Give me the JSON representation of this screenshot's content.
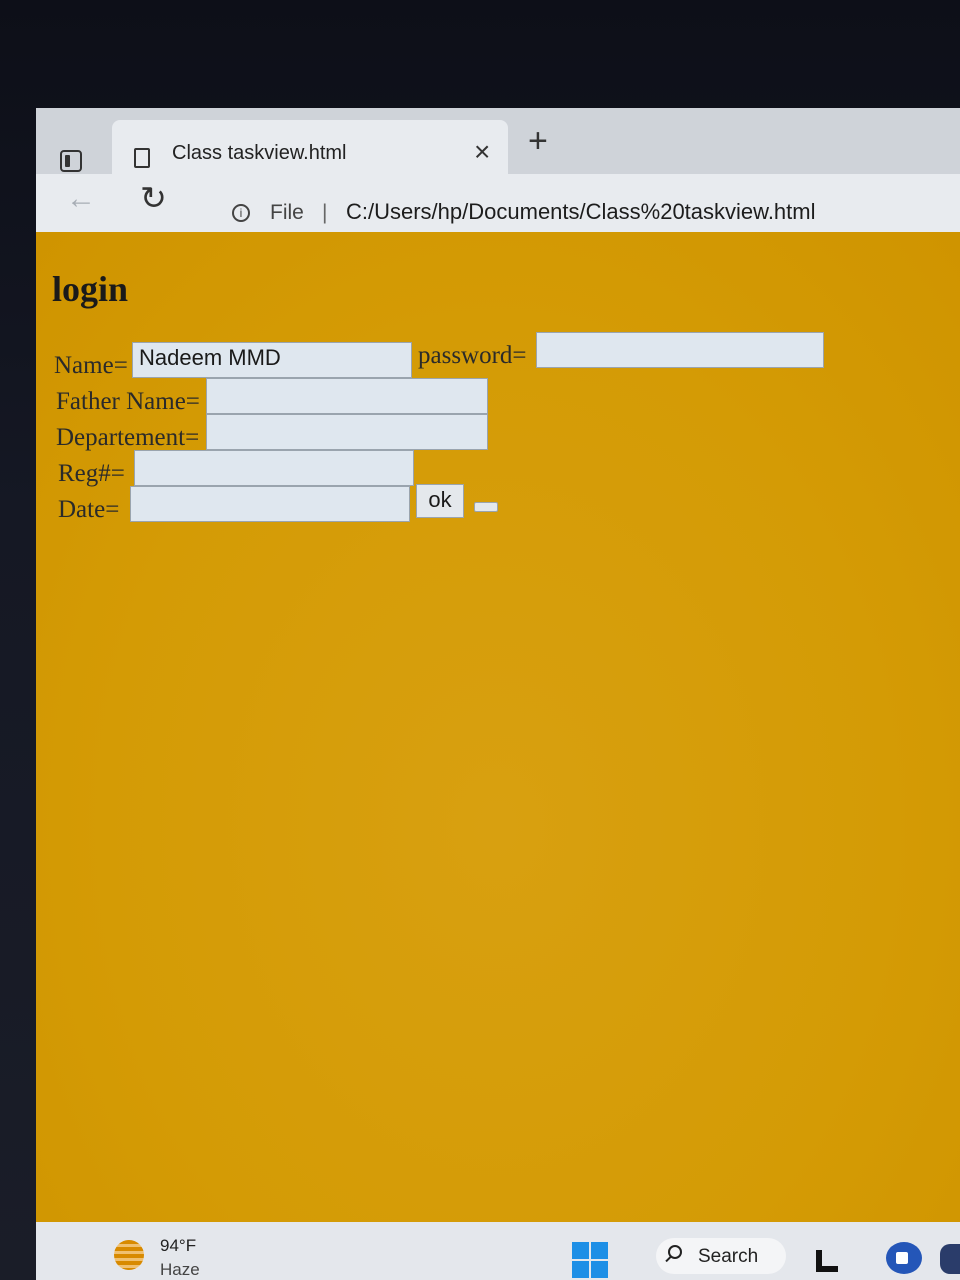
{
  "browser": {
    "tab": {
      "title": "Class taskview.html",
      "close_glyph": "×",
      "page_icon": "document-icon"
    },
    "new_tab_glyph": "+",
    "toolbar": {
      "back_glyph": "←",
      "refresh_glyph": "↻",
      "info_glyph": "i",
      "scheme_label": "File",
      "separator": "|",
      "url": "C:/Users/hp/Documents/Class%20taskview.html"
    }
  },
  "page": {
    "heading": "login",
    "fields": {
      "name_label": "Name=",
      "name_value": "Nadeem MMD",
      "password_label": "password=",
      "password_value": "",
      "father_name_label": "Father Name=",
      "father_name_value": "",
      "department_label": "Departement=",
      "department_value": "",
      "reg_label": "Reg#=",
      "reg_value": "",
      "date_label": "Date=",
      "date_value": ""
    },
    "ok_label": "ok",
    "background_color": "#d79c06"
  },
  "taskbar": {
    "weather_temp": "94°F",
    "weather_desc": "Haze",
    "search_label": "Search",
    "start_icon": "windows-start-icon",
    "accent_color": "#1d8fe6"
  }
}
